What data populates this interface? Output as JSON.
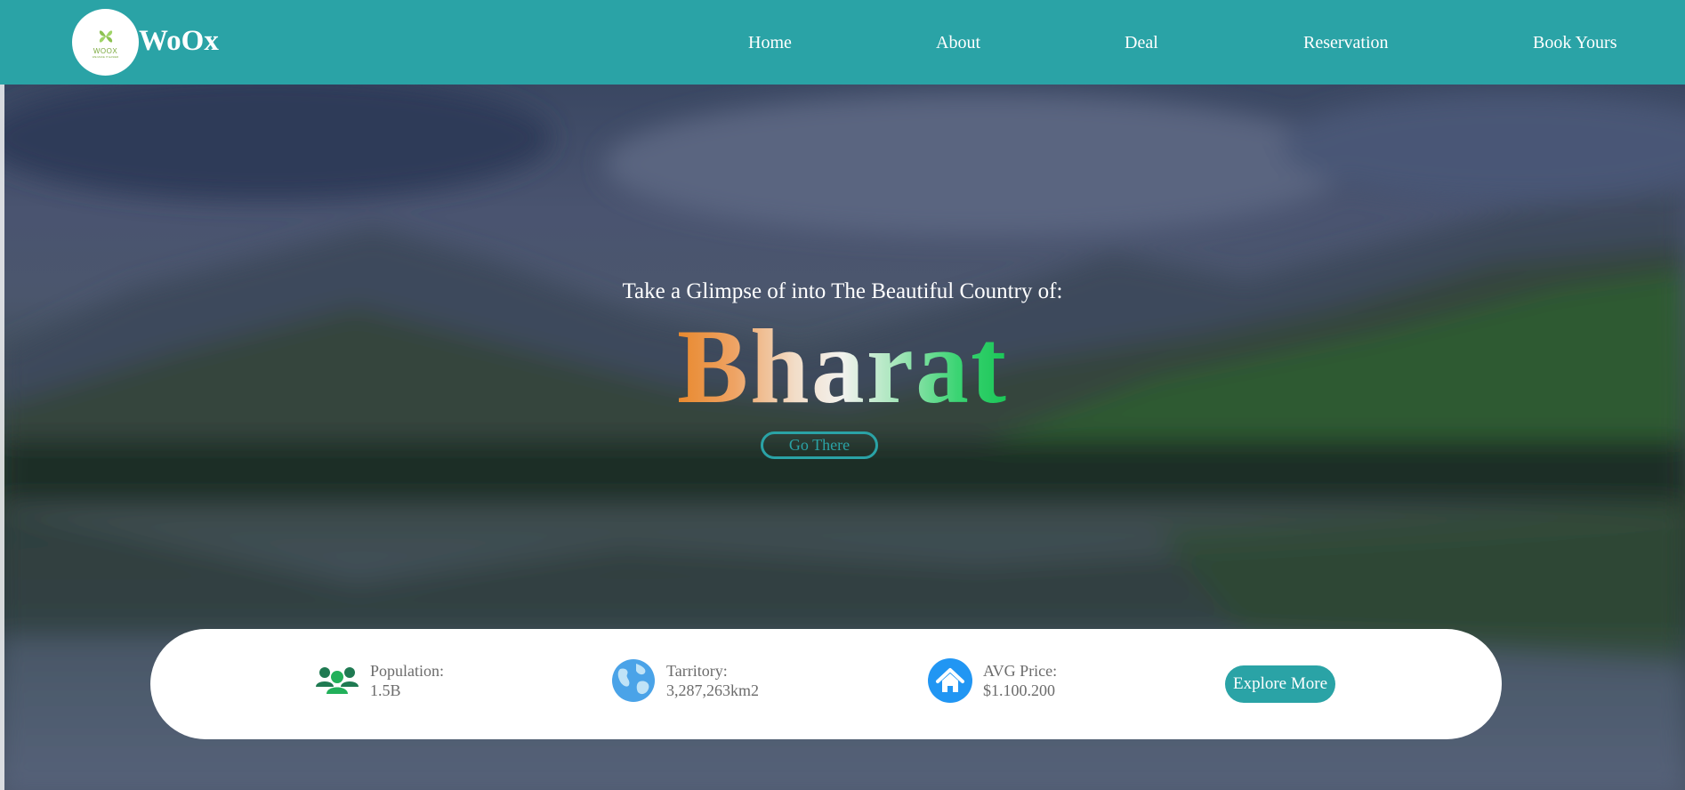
{
  "header": {
    "logo_small": "WOOX",
    "logo_tagline": "WE MAKE IT EASIER",
    "brand": "WoOx",
    "nav": [
      {
        "label": "Home"
      },
      {
        "label": "About"
      },
      {
        "label": "Deal"
      },
      {
        "label": "Reservation"
      },
      {
        "label": "Book Yours"
      }
    ]
  },
  "hero": {
    "subtitle": "Take a Glimpse of into The Beautiful Country of:",
    "country": "Bharat",
    "cta": "Go There"
  },
  "info_bar": {
    "stats": [
      {
        "label": "Population:",
        "value": "1.5B",
        "icon": "users-icon"
      },
      {
        "label": "Tarritory:",
        "value": "3,287,263km2",
        "icon": "globe-icon"
      },
      {
        "label": "AVG Price:",
        "value": "$1.100.200",
        "icon": "home-icon"
      }
    ],
    "explore": "Explore More"
  },
  "colors": {
    "primary": "#2aa3a6",
    "saffron": "#e8872a",
    "green": "#18c555",
    "blue": "#2196f3"
  }
}
